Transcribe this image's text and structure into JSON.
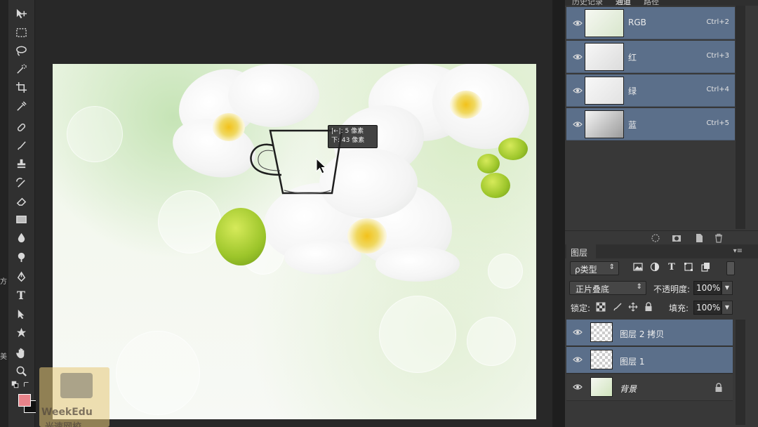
{
  "channels_panel": {
    "tabs": [
      "历史记录",
      "通道",
      "路径"
    ],
    "active_tab": "通道",
    "rows": [
      {
        "name": "RGB",
        "shortcut": "Ctrl+2"
      },
      {
        "name": "红",
        "shortcut": "Ctrl+3"
      },
      {
        "name": "绿",
        "shortcut": "Ctrl+4"
      },
      {
        "name": "蓝",
        "shortcut": "Ctrl+5"
      }
    ],
    "footer_icons": [
      "load-selection-icon",
      "save-selection-icon",
      "new-channel-icon",
      "trash-icon"
    ]
  },
  "layers_panel": {
    "tab_label": "图层",
    "filter_label": "ρ类型",
    "filter_icons": [
      "image-filter-icon",
      "adjustment-filter-icon",
      "type-filter-icon",
      "shape-filter-icon",
      "smart-object-filter-icon"
    ],
    "blend_mode": "正片叠底",
    "opacity_label": "不透明度:",
    "opacity_value": "100%",
    "lock_label": "锁定:",
    "fill_label": "填充:",
    "fill_value": "100%",
    "layers": [
      {
        "name": "图层 2 拷贝",
        "selected": true
      },
      {
        "name": "图层 1",
        "selected": true
      },
      {
        "name": "背景",
        "selected": false,
        "locked": true
      }
    ]
  },
  "canvas": {
    "tooltip_line1": "|←|: 5 像素",
    "tooltip_line2": "下: 43 像素"
  },
  "watermark": {
    "line1": "WeekEdu",
    "line2": "光速网校"
  },
  "toolbar": {
    "foreground_color": "#e8838a",
    "background_color": "#111111",
    "tools": [
      "move-tool-icon",
      "marquee-tool-icon",
      "lasso-tool-icon",
      "quick-selection-icon",
      "crop-tool-icon",
      "eyedropper-icon",
      "healing-brush-icon",
      "brush-tool-icon",
      "clone-stamp-icon",
      "history-brush-icon",
      "eraser-icon",
      "gradient-icon",
      "blur-tool-icon",
      "dodge-tool-icon",
      "pen-tool-icon",
      "type-tool-icon",
      "path-selection-icon",
      "custom-shape-icon",
      "hand-tool-icon",
      "zoom-tool-icon"
    ]
  },
  "edge_glyphs": [
    "方",
    "美"
  ]
}
